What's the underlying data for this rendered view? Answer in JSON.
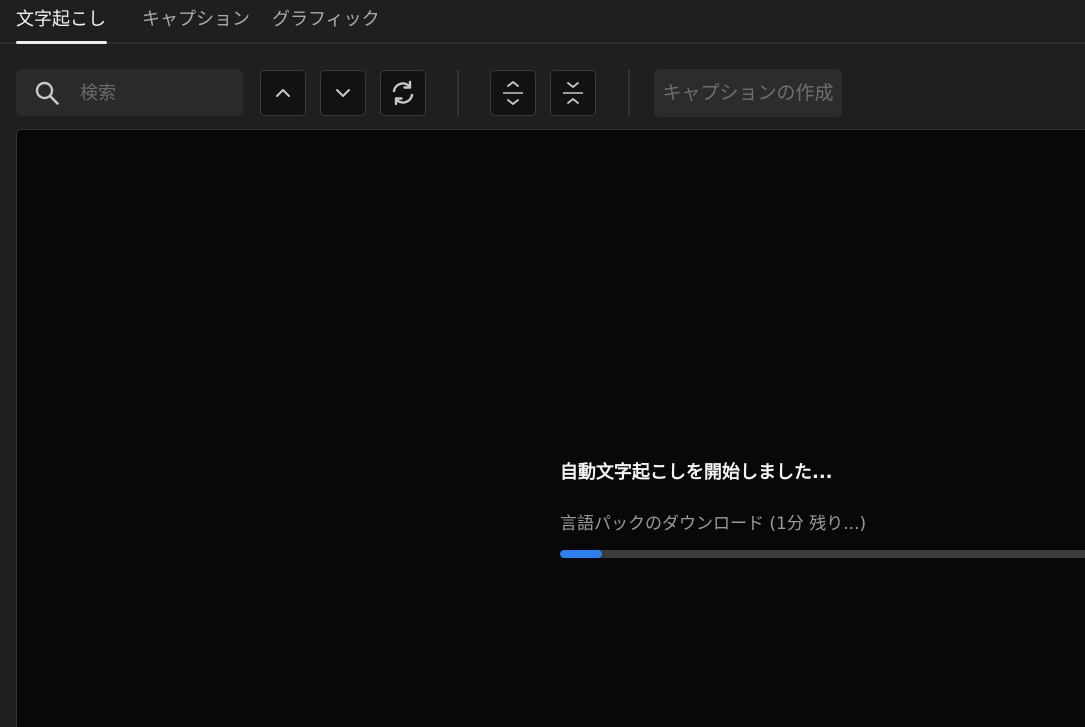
{
  "tabs": [
    {
      "label": "文字起こし",
      "active": true
    },
    {
      "label": "キャプション",
      "active": false
    },
    {
      "label": "グラフィック",
      "active": false
    }
  ],
  "toolbar": {
    "search": {
      "placeholder": "検索",
      "value": "",
      "icon": "search-icon"
    },
    "buttons": [
      {
        "icon": "chevron-up-icon"
      },
      {
        "icon": "chevron-down-icon"
      },
      {
        "icon": "refresh-icon"
      },
      {
        "icon": "expand-icon"
      },
      {
        "icon": "collapse-icon"
      }
    ],
    "create_caption_label": "キャプションの作成"
  },
  "status": {
    "title": "自動文字起こしを開始しました...",
    "subtitle": "言語パックのダウンロード (1分 残り...)",
    "progress_percent": 8
  },
  "colors": {
    "background": "#1f1f1f",
    "panel": "#080808",
    "accent": "#2d7ff0"
  }
}
